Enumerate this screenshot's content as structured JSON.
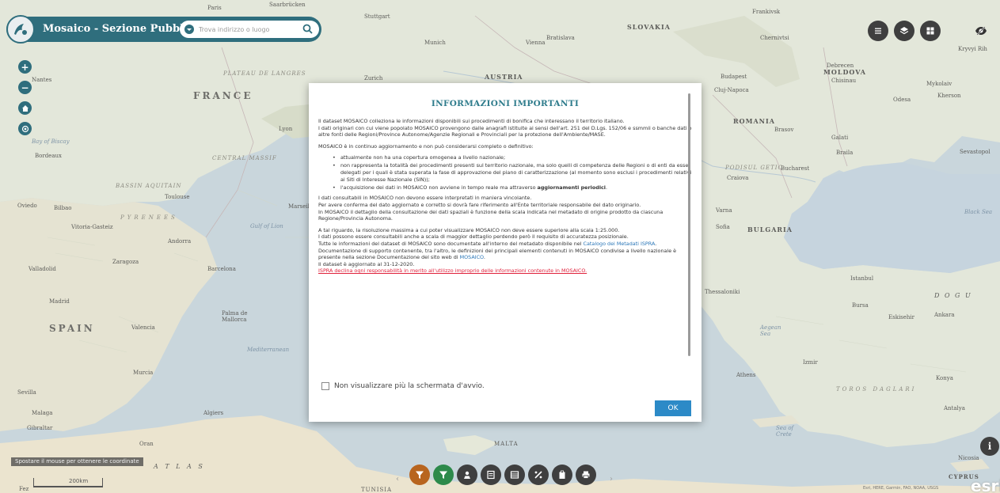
{
  "header": {
    "title": "Mosaico - Sezione Pubblica",
    "search_placeholder": "Trova indirizzo o luogo"
  },
  "map": {
    "labels": {
      "paris": "Paris",
      "saarbrucken": "Saarbrücken",
      "stuttgart": "Stuttgart",
      "slovakia": "SLOVAKIA",
      "frankfurt": "Frankivsk",
      "munich": "Munich",
      "vienna": "Vienna",
      "bratislava": "Bratislava",
      "chernivtsi": "Chernivtsi",
      "kryvyi_rih": "Kryvyi Rih",
      "nantes": "Nantes",
      "plateau": "PLATEAU DE LANGRES",
      "zurich": "Zurich",
      "austria": "AUSTRIA",
      "budapest": "Budapest",
      "debrecen": "Debrecen",
      "moldova": "MOLDOVA",
      "chisinau": "Chisinau",
      "mykolaiv": "Mykolaiv",
      "france": "FRANCE",
      "cluj": "Cluj-Napoca",
      "odesa": "Odesa",
      "kherson": "Kherson",
      "lyon": "Lyon",
      "romania": "ROMANIA",
      "brasov": "Brasov",
      "galati": "Galati",
      "bay_biscay": "Bay of Biscay",
      "bordeaux": "Bordeaux",
      "central_massif": "CENTRAL MASSIF",
      "braila": "Braila",
      "sevastopol": "Sevastopol",
      "podisul": "PODISUL GETIC",
      "bucharest": "Bucharest",
      "craiova": "Craiova",
      "bassin": "BASSIN AQUITAIN",
      "toulouse": "Toulouse",
      "marseille": "Marseille",
      "oviedo": "Oviedo",
      "bilbao": "Bilbao",
      "pyrenees": "PYRENEES",
      "gulf_lion": "Gulf of Lion",
      "varna": "Varna",
      "black_sea": "Black Sea",
      "vitoria": "Vitoria-Gasteiz",
      "andorra": "Andorra",
      "sofia": "Sofia",
      "bulgaria": "BULGARIA",
      "zaragoza": "Zaragoza",
      "valladolid": "Valladolid",
      "barcelona": "Barcelona",
      "istanbul": "Istanbul",
      "madrid": "Madrid",
      "thessaloniki": "Thessaloniki",
      "bursa": "Bursa",
      "ankara": "Ankara",
      "palma": "Palma de Mallorca",
      "spain": "SPAIN",
      "valencia": "Valencia",
      "eskisehir": "Eskisehir",
      "aegean": "Aegean Sea",
      "mediterranean": "Mediterranean",
      "murcia": "Murcia",
      "izmir": "Izmir",
      "athens": "Athens",
      "konya": "Konya",
      "sevilla": "Sevilla",
      "toros": "TOROS DAGLARI",
      "malaga": "Malaga",
      "algiers": "Algiers",
      "antalya": "Antalya",
      "gibraltar": "Gibraltar",
      "sea_crete": "Sea of Crete",
      "oran": "Oran",
      "malta": "MALTA",
      "nicosia": "Nicosia",
      "cyprus": "CYPRUS",
      "fez": "Fez",
      "tunisia": "TUNISIA",
      "dogu": "D O G U",
      "atlas": "A T L A S"
    }
  },
  "coords_hint": "Spostare il mouse per ottenere le coordinate",
  "scale_label": "200km",
  "attribution": "Esri, HERE, Garmin, FAO, NOAA, USGS",
  "esri_logo": "esri",
  "modal": {
    "title": "INFORMAZIONI IMPORTANTI",
    "p1": "Il dataset MOSAICO colleziona le informazioni disponibili sui procedimenti di bonifica che interessano il territorio italiano.",
    "p2": "I dati originari con cui viene popolato MOSAICO provengono dalle anagrafi istituite ai sensi dell'art. 251 del D.Lgs. 152/06 e ssmmii o banche dati o altre fonti delle Regioni/Province Autonome/Agenzie Regionali e Provinciali per la protezione dell'Ambiente/MASE.",
    "p3": "MOSAICO è in continuo aggiornamento e non può considerarsi completo o definitivo:",
    "bullets": [
      "attualmente non ha una copertura omogenea a livello nazionale;",
      "non rappresenta la totalità dei procedimenti presenti sul territorio nazionale, ma solo quelli di competenza delle Regioni o di enti da esse delegati per i quali è stata superata la fase di approvazione del piano di caratterizzazione (al momento sono esclusi i procedimenti relativi ai Siti di Interesse Nazionale (SIN));"
    ],
    "bullet3_pre": "l'acquisizione dei dati in MOSAICO non avviene in tempo reale ma attraverso ",
    "bullet3_strong": "aggiornamenti periodici",
    "bullet3_post": ".",
    "p4a": "I dati consultabili in MOSAICO non devono essere interpretati in maniera vincolante.",
    "p4b": "Per avere conferma del dato aggiornato e corretto si dovrà fare riferimento all'Ente territoriale responsabile del dato originario.",
    "p4c": "In MOSAICO il dettaglio della consultazione dei dati spaziali è funzione della scala indicata nel metadato di origine prodotto da ciascuna Regione/Provincia Autonoma.",
    "p5a": "A tal riguardo, la risoluzione massima a cui poter visualizzare MOSAICO non deve essere superiore alla scala 1:25.000.",
    "p5b": "I dati possono essere consultabili anche a scala di maggior dettaglio perdendo però il requisito di accuratezza posizionale.",
    "p5c_pre": "Tutte le informazioni del dataset di MOSAICO sono documentate all'interno del metadato disponibile nel ",
    "p5c_link": "Catalogo dei Metadati ISPRA",
    "p5c_post": ".",
    "p5d_pre": "Documentazione di supporto contenente, tra l'altro, le definizioni dei principali elementi contenuti in MOSAICO condivise a livello nazionale è presente nella sezione Documentazione del sito web di ",
    "p5d_link": "MOSAICO",
    "p5d_post": ".",
    "p5e": "Il dataset è aggiornato al 31-12-2020.",
    "warning": "ISPRA declina ogni responsabilità in merito all'utilizzo improprio delle informazioni contenute in MOSAICO.",
    "checkbox_label": "Non visualizzare più la schermata d'avvio.",
    "ok_label": "OK"
  },
  "colors": {
    "accent": "#2f6e7d",
    "button": "#2c8ac7",
    "toolbar_dark": "#3f3f3f",
    "filter_brown": "#b8651f",
    "filter_green": "#2d8a4b",
    "warning": "#e0213b"
  },
  "icons": {
    "zoom_in": "+",
    "zoom_out": "−",
    "home": "home-icon",
    "locate": "locate-icon",
    "info": "i"
  }
}
